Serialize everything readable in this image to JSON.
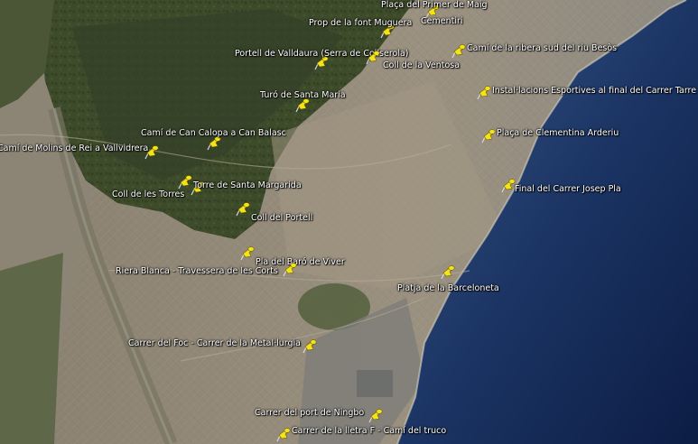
{
  "placemark_color": "#f4e21a",
  "placemarks": [
    {
      "id": "placa-primer-maig",
      "label": "Plaça del Primer de Maig",
      "icon": "pushpin-icon"
    },
    {
      "id": "prop-font-muguera",
      "label": "Prop de la font Muguera",
      "icon": "pushpin-icon"
    },
    {
      "id": "cementiri",
      "label": "Cementiri",
      "icon": "pushpin-icon"
    },
    {
      "id": "cami-ribera-besos",
      "label": "Camí de la ribera sud del riu Besòs",
      "icon": "pushpin-icon"
    },
    {
      "id": "portell-valldaura",
      "label": "Portell de Valldaura (Serra de Collserola)",
      "icon": "pushpin-icon"
    },
    {
      "id": "coll-ventosa",
      "label": "Coll de la Ventosa",
      "icon": "pushpin-icon"
    },
    {
      "id": "turo-santa-maria",
      "label": "Turó de Santa Maria",
      "icon": "pushpin-icon"
    },
    {
      "id": "installacions-esportives",
      "label": "Instal·lacions Esportives al final del Carrer Tarre",
      "icon": "pushpin-icon"
    },
    {
      "id": "cami-can-calopa",
      "label": "Camí de Can Calopa a Can Balasc",
      "icon": "pushpin-icon"
    },
    {
      "id": "placa-clementina-arderiu",
      "label": "Plaça de Clementina Arderiu",
      "icon": "pushpin-icon"
    },
    {
      "id": "cami-molins-vallvidrera",
      "label": "Camí de Molins de Rei a Vallvidrera",
      "icon": "pushpin-icon"
    },
    {
      "id": "torre-santa-margarida",
      "label": "Torre de Santa Margarida",
      "icon": "pushpin-icon"
    },
    {
      "id": "coll-torres",
      "label": "Coll de les Torres",
      "icon": "pushpin-icon"
    },
    {
      "id": "final-carrer-josep-pla",
      "label": "Final del Carrer Josep Pla",
      "icon": "pushpin-icon"
    },
    {
      "id": "coll-portell",
      "label": "Coll del Portell",
      "icon": "pushpin-icon"
    },
    {
      "id": "pla-baro-viver",
      "label": "Pla del Baró de Viver",
      "icon": "pushpin-icon"
    },
    {
      "id": "riera-blanca",
      "label": "Riera Blanca - Travessera de les Corts",
      "icon": "pushpin-icon"
    },
    {
      "id": "platja-barceloneta",
      "label": "Platja de la Barceloneta",
      "icon": "pushpin-icon"
    },
    {
      "id": "carrer-foc",
      "label": "Carrer del Foc - Carrer de la Metal·lurgia",
      "icon": "pushpin-icon"
    },
    {
      "id": "carrer-port-ningbo",
      "label": "Carrer del port de Ningbo",
      "icon": "pushpin-icon"
    },
    {
      "id": "carrer-lletra-f",
      "label": "Carrer de la lletra F - Camí del truco",
      "icon": "pushpin-icon"
    }
  ]
}
